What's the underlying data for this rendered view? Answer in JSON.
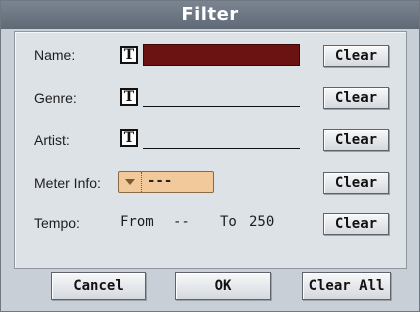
{
  "dialog": {
    "title": "Filter"
  },
  "fields": {
    "name_label": "Name:",
    "genre_label": "Genre:",
    "artist_label": "Artist:",
    "meter_label": "Meter Info:",
    "tempo_label": "Tempo:",
    "text_icon_glyph": "T",
    "name_value": "",
    "genre_value": "",
    "artist_value": "",
    "meter_value": "---",
    "tempo_from_label": "From",
    "tempo_from_value": "--",
    "tempo_to_label": "To",
    "tempo_to_value": "250"
  },
  "buttons": {
    "clear": "Clear",
    "cancel": "Cancel",
    "ok": "OK",
    "clear_all": "Clear All"
  },
  "colors": {
    "active_field": "#6b1212",
    "dropdown_bg": "#f2c99a",
    "title_bg": "#66717d"
  }
}
